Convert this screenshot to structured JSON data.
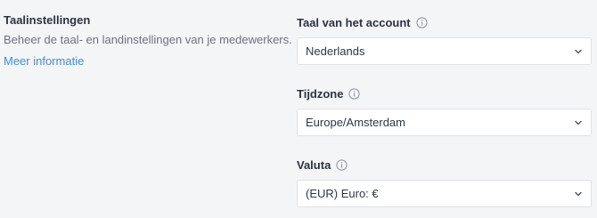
{
  "section": {
    "title": "Taalinstellingen",
    "description": "Beheer de taal- en landinstellingen van je medewerkers.",
    "link": "Meer informatie"
  },
  "fields": {
    "account_language": {
      "label": "Taal van het account",
      "value": "Nederlands"
    },
    "timezone": {
      "label": "Tijdzone",
      "value": "Europe/Amsterdam"
    },
    "currency": {
      "label": "Valuta",
      "value": "(EUR) Euro: €"
    }
  },
  "icons": {
    "info": "info-icon",
    "dropdown": "chevron-down-icon"
  },
  "colors": {
    "link": "#3b8fd8",
    "background": "#f4f5f7",
    "field_border": "#dfe2e6"
  }
}
